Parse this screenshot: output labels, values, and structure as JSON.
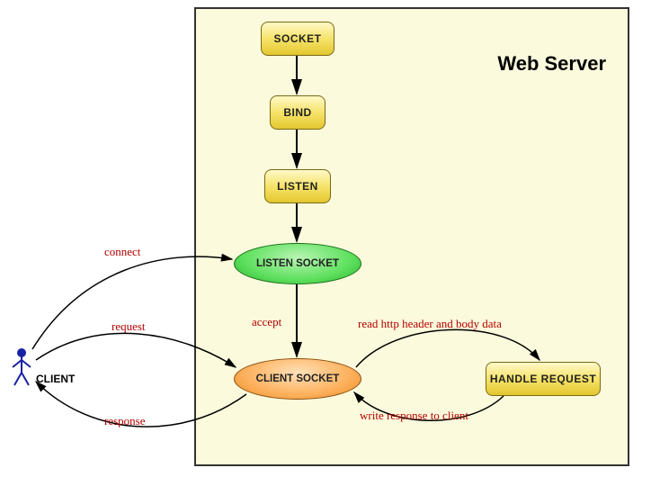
{
  "server": {
    "title": "Web Server"
  },
  "nodes": {
    "socket": "SOCKET",
    "bind": "BIND",
    "listen": "LISTEN",
    "listen_socket": "LISTEN SOCKET",
    "client_socket": "CLIENT SOCKET",
    "handle_request": "HANDLE REQUEST"
  },
  "client": {
    "label": "CLIENT"
  },
  "edges": {
    "connect": "connect",
    "accept": "accept",
    "request": "request",
    "response": "response",
    "read": "read http header and body data",
    "write": "write response to client"
  }
}
